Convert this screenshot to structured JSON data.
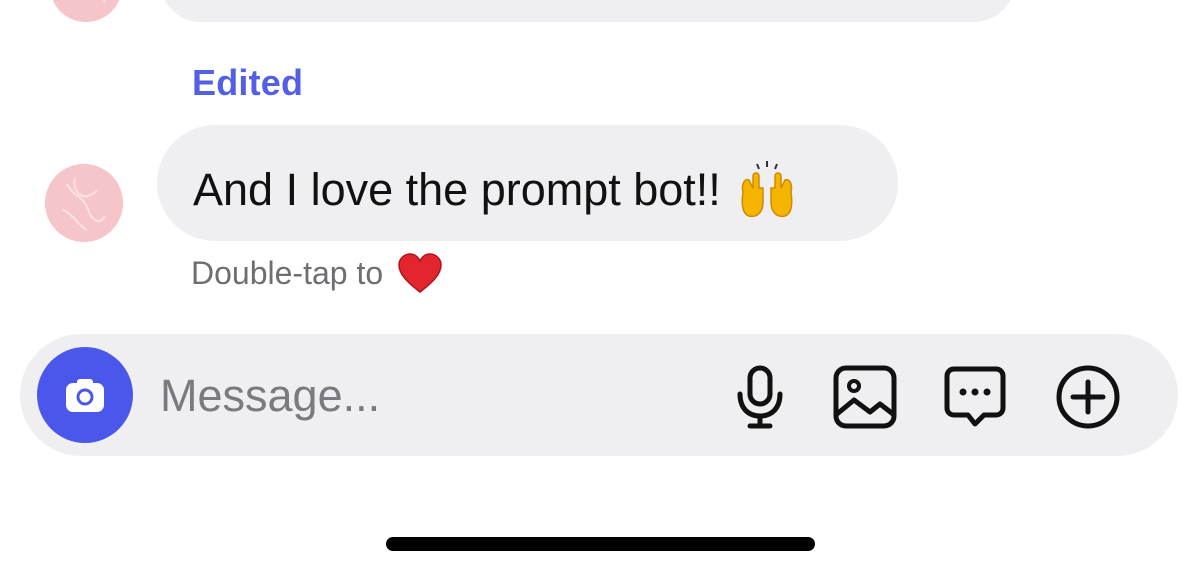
{
  "thread": {
    "edited_label": "Edited",
    "message_text": "And I love the prompt bot!!",
    "message_emoji": "raising-hands-emoji",
    "hint_text": "Double-tap to",
    "hint_emoji": "red-heart-emoji"
  },
  "composer": {
    "placeholder": "Message...",
    "icons": {
      "camera": "camera-icon",
      "mic": "microphone-icon",
      "gallery": "image-icon",
      "sticker": "sticker-chat-icon",
      "plus": "plus-circle-icon"
    },
    "accent_color": "#4b57eb"
  },
  "colors": {
    "bubble": "#efeff1",
    "edited_label": "#5360e6",
    "hint_text": "#6e6e72",
    "avatar": "#f5c5c9"
  }
}
